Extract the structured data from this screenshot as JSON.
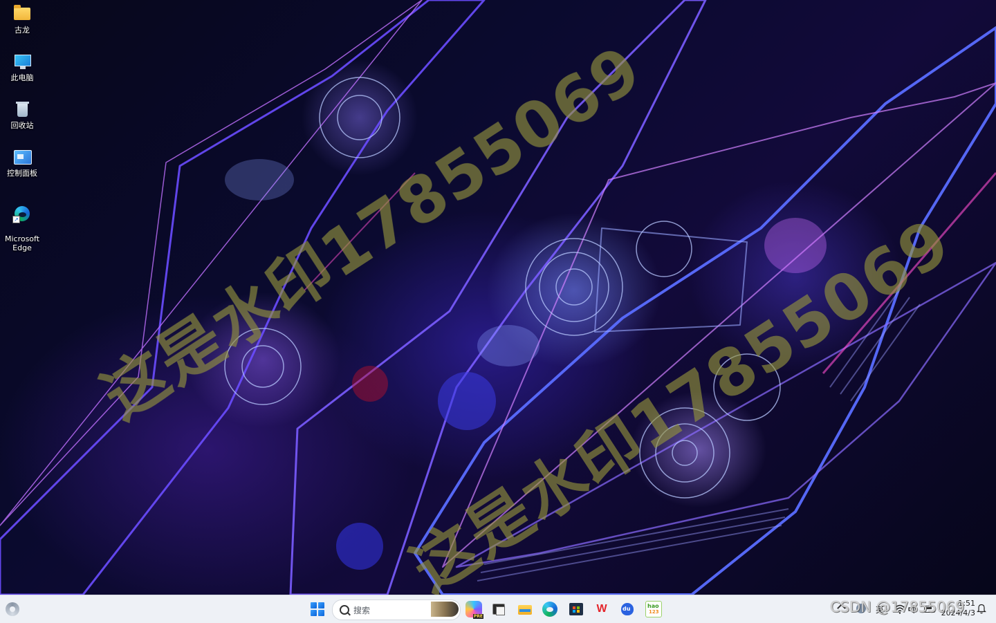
{
  "desktop": {
    "icons": [
      {
        "label": "古龙",
        "icon": "folder-icon"
      },
      {
        "label": "此电脑",
        "icon": "computer-icon"
      },
      {
        "label": "回收站",
        "icon": "recycle-bin-icon"
      },
      {
        "label": "控制面板",
        "icon": "control-panel-icon"
      },
      {
        "label": "Microsoft\nEdge",
        "icon": "edge-icon"
      }
    ],
    "watermark_text": "这是水印17855069"
  },
  "taskbar": {
    "left_widget_icon": "widgets-icon",
    "start_icon": "windows-start-icon",
    "search": {
      "placeholder": "搜索"
    },
    "pinned_apps": [
      {
        "name": "Copilot",
        "icon": "copilot-icon"
      },
      {
        "name": "Terminal",
        "icon": "terminal-icon"
      },
      {
        "name": "File Explorer",
        "icon": "file-explorer-icon"
      },
      {
        "name": "Microsoft Edge",
        "icon": "edge-icon"
      },
      {
        "name": "Microsoft Store",
        "icon": "store-icon"
      },
      {
        "name": "WPS",
        "icon": "wps-icon",
        "glyph": "W"
      },
      {
        "name": "Baidu",
        "icon": "baidu-icon"
      },
      {
        "name": "hao123",
        "icon": "hao123-icon"
      }
    ],
    "tray": {
      "language": "英",
      "time": "1:51",
      "date": "2024/4/3"
    }
  },
  "overlay": {
    "csdn_watermark": "CSDN @17855069"
  },
  "colors": {
    "taskbar_bg": "#eef1f6",
    "watermark": "#96963c",
    "wallpaper_base": "#0a0a2e"
  }
}
